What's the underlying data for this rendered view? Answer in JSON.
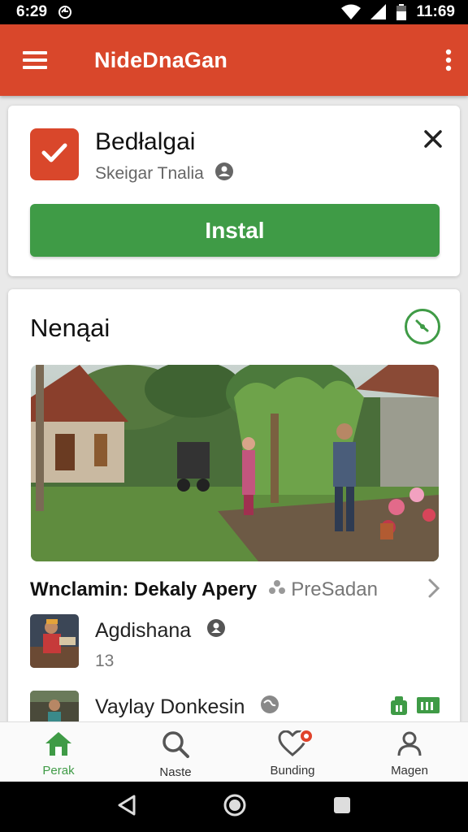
{
  "status_bar": {
    "time": "6:29",
    "clock": "11:69"
  },
  "app_bar": {
    "title": "NideDnaGan",
    "menu_icon": "menu-icon",
    "more_icon": "more-vert-icon"
  },
  "install_card": {
    "app_name": "Bedłalgai",
    "subtitle": "Skeigar Tnalia",
    "install_label": "Instal",
    "icon": "check-icon"
  },
  "feed": {
    "section_title": "Nenąai",
    "article": {
      "title": "Wnclamin: Dekaly Apery",
      "meta": "PreSadan"
    },
    "items": [
      {
        "title": "Agdishana",
        "subtitle": "13"
      },
      {
        "title": "Vaylay Donkesin",
        "subtitle": ""
      }
    ]
  },
  "bottom_nav": [
    {
      "label": "Perak",
      "icon": "home-icon",
      "active": true
    },
    {
      "label": "Naste",
      "icon": "search-icon",
      "active": false
    },
    {
      "label": "Bunding",
      "icon": "heart-icon",
      "active": false
    },
    {
      "label": "Magen",
      "icon": "profile-icon",
      "active": false
    }
  ],
  "colors": {
    "accent": "#d9472b",
    "green": "#3f9b46"
  }
}
